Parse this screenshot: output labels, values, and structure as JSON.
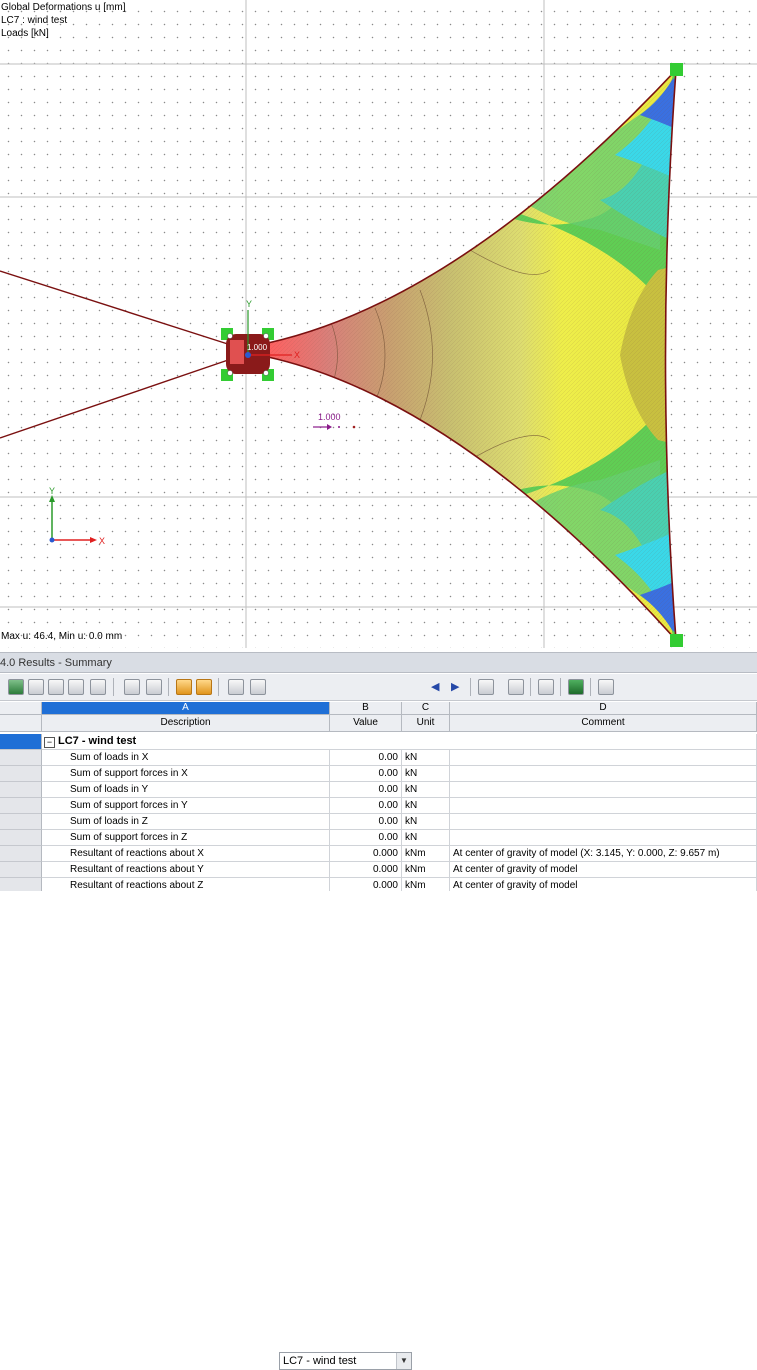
{
  "viewport": {
    "info_lines": [
      "Global Deformations u [mm]",
      "LC7 : wind  test",
      "Loads [kN]"
    ],
    "max_min_label": "Max u: 46.4, Min u: 0.0 mm",
    "load_value_label": "1.000",
    "node_label": "1.000",
    "axis_x_label": "X",
    "axis_y_label": "Y"
  },
  "panel": {
    "title": "4.0 Results - Summary",
    "loadcase_selected": "LC7 - wind  test"
  },
  "table": {
    "column_letters": [
      "A",
      "B",
      "C",
      "D"
    ],
    "column_headers": [
      "Description",
      "Value",
      "Unit",
      "Comment"
    ],
    "group_label": "LC7 - wind  test",
    "rows": [
      {
        "description": "Sum of loads in X",
        "value": "0.00",
        "unit": "kN",
        "comment": ""
      },
      {
        "description": "Sum of support forces in X",
        "value": "0.00",
        "unit": "kN",
        "comment": ""
      },
      {
        "description": "Sum of loads in Y",
        "value": "0.00",
        "unit": "kN",
        "comment": ""
      },
      {
        "description": "Sum of support forces in Y",
        "value": "0.00",
        "unit": "kN",
        "comment": ""
      },
      {
        "description": "Sum of loads in Z",
        "value": "0.00",
        "unit": "kN",
        "comment": ""
      },
      {
        "description": "Sum of support forces in Z",
        "value": "0.00",
        "unit": "kN",
        "comment": ""
      },
      {
        "description": "Resultant of reactions about X",
        "value": "0.000",
        "unit": "kNm",
        "comment": "At center of gravity of model (X: 3.145, Y: 0.000, Z: 9.657 m)"
      },
      {
        "description": "Resultant of reactions about Y",
        "value": "0.000",
        "unit": "kNm",
        "comment": "At center of gravity of model"
      },
      {
        "description": "Resultant of reactions about Z",
        "value": "0.000",
        "unit": "kNm",
        "comment": "At center of gravity of model"
      }
    ]
  },
  "colors": {
    "selection_blue": "#1f6fd6",
    "cable": "#7a1010",
    "support_green": "#33cc33"
  }
}
